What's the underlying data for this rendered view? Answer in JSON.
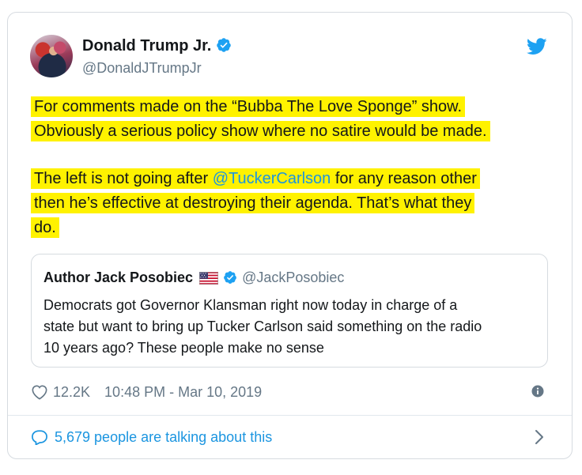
{
  "tweet": {
    "author_name": "Donald Trump Jr.",
    "handle": "@DonaldJTrumpJr",
    "text_lines": {
      "p1_l1": "For comments made on the “Bubba The Love Sponge” show.",
      "p1_l2": "Obviously a serious policy show where no satire would be made.",
      "p2_pre": "The left is not going after ",
      "p2_mention": "@TuckerCarlson",
      "p2_post": " for any reason other",
      "p2_l2": "then he’s effective at destroying their agenda. That’s what they",
      "p2_l3": "do."
    },
    "likes": "12.2K",
    "timestamp": "10:48 PM - Mar 10, 2019",
    "talking": "5,679 people are talking about this"
  },
  "quoted": {
    "author_name": "Author Jack Posobiec",
    "handle": "@JackPosobiec",
    "text_lines": [
      "Democrats got Governor Klansman right now today in charge of a",
      "state but want to bring up Tucker Carlson said something on the radio",
      "10 years ago? These people make no sense"
    ]
  },
  "icons": {
    "verified": "verified-badge-icon",
    "bird": "twitter-bird-icon",
    "flag": "us-flag-icon",
    "heart": "heart-icon",
    "info": "info-icon",
    "bubble": "speech-bubble-icon",
    "chevron": "chevron-right-icon"
  },
  "colors": {
    "highlight": "#fff200",
    "link": "#1b95e0",
    "secondary_text": "#657786",
    "border": "#d6dbe0"
  }
}
